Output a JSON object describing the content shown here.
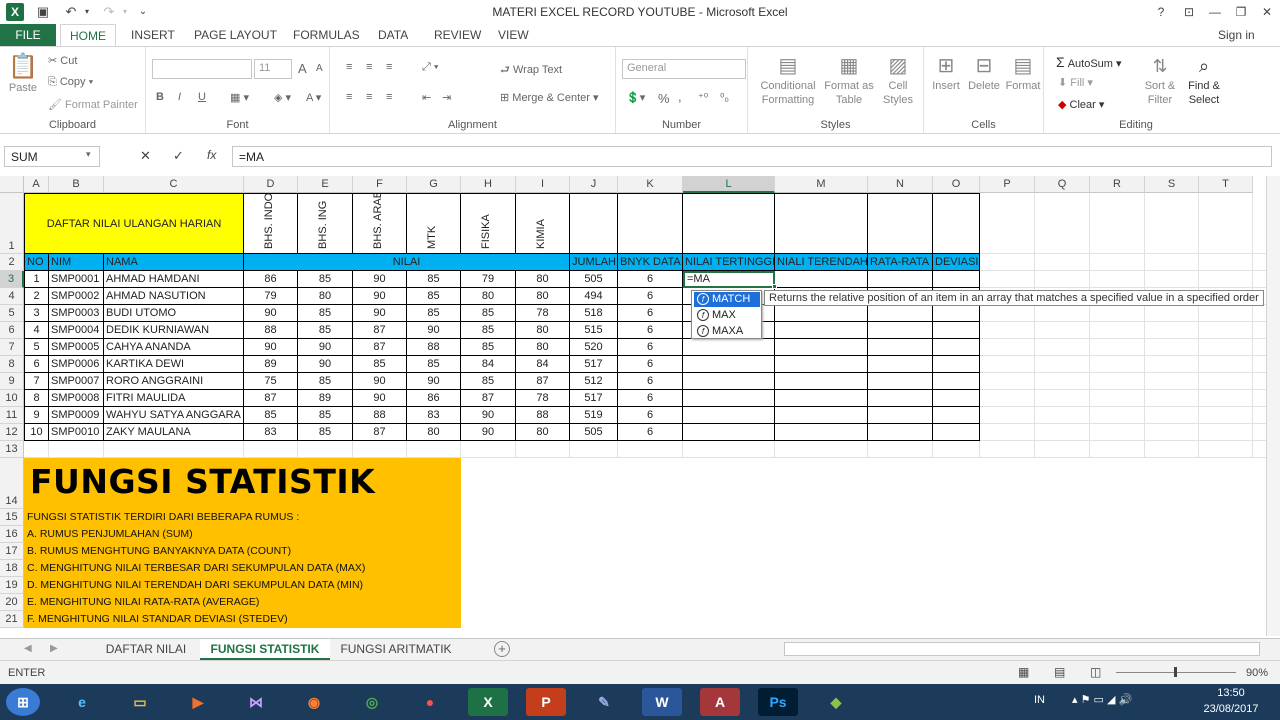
{
  "window": {
    "title": "MATERI EXCEL RECORD YOUTUBE - Microsoft Excel",
    "signin": "Sign in",
    "help": "?"
  },
  "ribbon_tabs": [
    "FILE",
    "HOME",
    "INSERT",
    "PAGE LAYOUT",
    "FORMULAS",
    "DATA",
    "REVIEW",
    "VIEW"
  ],
  "ribbon": {
    "clipboard": {
      "label": "Clipboard",
      "paste": "Paste",
      "cut": "Cut",
      "copy": "Copy",
      "format_painter": "Format Painter"
    },
    "font": {
      "label": "Font",
      "size": "11",
      "bold": "B",
      "italic": "I",
      "underline": "U",
      "grow": "A",
      "shrink": "A",
      "color": "A"
    },
    "alignment": {
      "label": "Alignment",
      "wrap": "Wrap Text",
      "merge": "Merge & Center"
    },
    "number": {
      "label": "Number",
      "format": "General",
      "pct": "%",
      "comma": ","
    },
    "styles": {
      "label": "Styles",
      "cond": "Conditional Formatting",
      "table": "Format as Table",
      "cell": "Cell Styles"
    },
    "cells": {
      "label": "Cells",
      "insert": "Insert",
      "delete": "Delete",
      "format": "Format"
    },
    "editing": {
      "label": "Editing",
      "autosum": "AutoSum",
      "fill": "Fill",
      "clear": "Clear",
      "sort": "Sort & Filter",
      "find": "Find & Select"
    }
  },
  "formula_bar": {
    "name_box": "SUM",
    "formula": "=MA",
    "cancel": "✕",
    "enter": "✓",
    "fx": "fx"
  },
  "columns": [
    "A",
    "B",
    "C",
    "D",
    "E",
    "F",
    "G",
    "H",
    "I",
    "J",
    "K",
    "L",
    "M",
    "N",
    "O",
    "P",
    "Q",
    "R",
    "S",
    "T"
  ],
  "rows": [
    "1",
    "2",
    "3",
    "4",
    "5",
    "6",
    "7",
    "8",
    "9",
    "10",
    "11",
    "12",
    "13",
    "14",
    "15",
    "16",
    "17",
    "18",
    "19",
    "20",
    "21"
  ],
  "sheet": {
    "title": "DAFTAR NILAI ULANGAN HARIAN",
    "subjects": [
      "BHS. INDO",
      "BHS. ING",
      "BHS. ARAB",
      "MTK",
      "FISIKA",
      "KIMIA"
    ],
    "headers": {
      "no": "NO",
      "nim": "NIM",
      "nama": "NAMA",
      "nilai": "NILAI",
      "jumlah": "JUMLAH",
      "bnyk": "BNYK DATA",
      "tinggi": "NILAI TERTINGGI",
      "rendah": "NIALI TERENDAH",
      "rata": "RATA-RATA",
      "deviasi": "DEVIASI"
    },
    "students": [
      {
        "no": "1",
        "nim": "SMP0001",
        "nama": "AHMAD HAMDANI",
        "scores": [
          "86",
          "85",
          "90",
          "85",
          "79",
          "80"
        ],
        "jumlah": "505",
        "bnyk": "6"
      },
      {
        "no": "2",
        "nim": "SMP0002",
        "nama": "AHMAD NASUTION",
        "scores": [
          "79",
          "80",
          "90",
          "85",
          "80",
          "80"
        ],
        "jumlah": "494",
        "bnyk": "6"
      },
      {
        "no": "3",
        "nim": "SMP0003",
        "nama": "BUDI UTOMO",
        "scores": [
          "90",
          "85",
          "90",
          "85",
          "85",
          "78"
        ],
        "jumlah": "518",
        "bnyk": "6"
      },
      {
        "no": "4",
        "nim": "SMP0004",
        "nama": "DEDIK KURNIAWAN",
        "scores": [
          "88",
          "85",
          "87",
          "90",
          "85",
          "80"
        ],
        "jumlah": "515",
        "bnyk": "6"
      },
      {
        "no": "5",
        "nim": "SMP0005",
        "nama": "CAHYA ANANDA",
        "scores": [
          "90",
          "90",
          "87",
          "88",
          "85",
          "80"
        ],
        "jumlah": "520",
        "bnyk": "6"
      },
      {
        "no": "6",
        "nim": "SMP0006",
        "nama": "KARTIKA DEWI",
        "scores": [
          "89",
          "90",
          "85",
          "85",
          "84",
          "84"
        ],
        "jumlah": "517",
        "bnyk": "6"
      },
      {
        "no": "7",
        "nim": "SMP0007",
        "nama": "RORO ANGGRAINI",
        "scores": [
          "75",
          "85",
          "90",
          "90",
          "85",
          "87"
        ],
        "jumlah": "512",
        "bnyk": "6"
      },
      {
        "no": "8",
        "nim": "SMP0008",
        "nama": "FITRI MAULIDA",
        "scores": [
          "87",
          "89",
          "90",
          "86",
          "87",
          "78"
        ],
        "jumlah": "517",
        "bnyk": "6"
      },
      {
        "no": "9",
        "nim": "SMP0009",
        "nama": "WAHYU SATYA ANGGARA",
        "scores": [
          "85",
          "85",
          "88",
          "83",
          "90",
          "88"
        ],
        "jumlah": "519",
        "bnyk": "6"
      },
      {
        "no": "10",
        "nim": "SMP0010",
        "nama": "ZAKY MAULANA",
        "scores": [
          "83",
          "85",
          "87",
          "80",
          "90",
          "80"
        ],
        "jumlah": "505",
        "bnyk": "6"
      }
    ],
    "active_cell_text": "=MA",
    "box": {
      "heading": "FUNGSI STATISTIK",
      "lines": [
        "FUNGSI STATISTIK TERDIRI DARI BEBERAPA RUMUS :",
        "A. RUMUS PENJUMLAHAN (SUM)",
        "B. RUMUS MENGHTUNG BANYAKNYA DATA (COUNT)",
        "C. MENGHITUNG NILAI TERBESAR DARI SEKUMPULAN DATA (MAX)",
        "D. MENGHITUNG NILAI TERENDAH DARI SEKUMPULAN DATA (MIN)",
        "E. MENGHITUNG NILAI RATA-RATA (AVERAGE)",
        "F. MENGHITUNG NILAI STANDAR DEVIASI (STEDEV)"
      ]
    }
  },
  "autocomplete": {
    "items": [
      "MATCH",
      "MAX",
      "MAXA"
    ],
    "tooltip": "Returns the relative position of an item in an array that matches a specified value in a specified order"
  },
  "sheet_tabs": [
    "DAFTAR NILAI",
    "FUNGSI STATISTIK",
    "FUNGSI ARITMATIK"
  ],
  "status": {
    "mode": "ENTER",
    "zoom": "90%"
  },
  "taskbar": {
    "lang": "IN",
    "time": "13:50",
    "date": "23/08/2017"
  },
  "colors": {
    "excel_green": "#217346",
    "header_blue": "#00b0f0",
    "title_yellow": "#ffff00",
    "box_orange": "#ffc000"
  }
}
